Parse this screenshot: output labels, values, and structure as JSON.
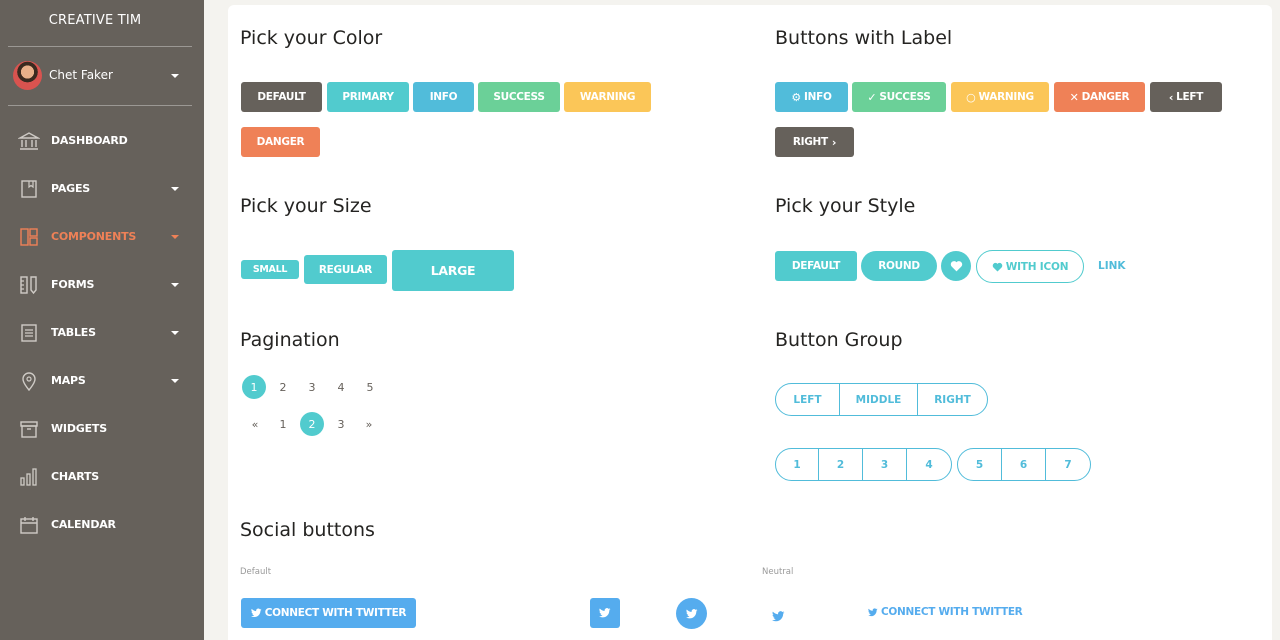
{
  "sidebar": {
    "brand": "CREATIVE TIM",
    "user": {
      "name": "Chet Faker"
    },
    "items": [
      {
        "label": "DASHBOARD",
        "icon": "bank-icon",
        "has_caret": false,
        "active": false
      },
      {
        "label": "PAGES",
        "icon": "book-icon",
        "has_caret": true,
        "active": false
      },
      {
        "label": "COMPONENTS",
        "icon": "layout-icon",
        "has_caret": true,
        "active": true
      },
      {
        "label": "FORMS",
        "icon": "ruler-pencil-icon",
        "has_caret": true,
        "active": false
      },
      {
        "label": "TABLES",
        "icon": "paper-icon",
        "has_caret": true,
        "active": false
      },
      {
        "label": "MAPS",
        "icon": "pin-icon",
        "has_caret": true,
        "active": false
      },
      {
        "label": "WIDGETS",
        "icon": "box-icon",
        "has_caret": false,
        "active": false
      },
      {
        "label": "CHARTS",
        "icon": "chart-bars-icon",
        "has_caret": false,
        "active": false
      },
      {
        "label": "CALENDAR",
        "icon": "calendar-icon",
        "has_caret": false,
        "active": false
      }
    ]
  },
  "colors": {
    "sidebar_bg": "#66615b",
    "active": "#ef8157",
    "default": "#66615b",
    "primary": "#51cbce",
    "info": "#51bcda",
    "success": "#6bd098",
    "warning": "#fbc658",
    "danger": "#ef8157",
    "twitter": "#55acee"
  },
  "color_section": {
    "title": "Pick your Color",
    "buttons": [
      "DEFAULT",
      "PRIMARY",
      "INFO",
      "SUCCESS",
      "WARNING",
      "DANGER"
    ]
  },
  "label_section": {
    "title": "Buttons with Label",
    "buttons": [
      {
        "label": "INFO",
        "icon": "gear-icon"
      },
      {
        "label": "SUCCESS",
        "icon": "check-icon"
      },
      {
        "label": "WARNING",
        "icon": "zoom-icon"
      },
      {
        "label": "DANGER",
        "icon": "close-icon"
      },
      {
        "label": "LEFT",
        "icon": "chevron-left-icon"
      },
      {
        "label": "RIGHT",
        "icon": "chevron-right-icon"
      }
    ]
  },
  "size_section": {
    "title": "Pick your Size",
    "small": "SMALL",
    "regular": "REGULAR",
    "large": "LARGE"
  },
  "style_section": {
    "title": "Pick your Style",
    "default": "DEFAULT",
    "round": "ROUND",
    "with_icon": "WITH ICON",
    "link": "LINK"
  },
  "pagination": {
    "title": "Pagination",
    "row1": [
      "1",
      "2",
      "3",
      "4",
      "5"
    ],
    "row1_active": "1",
    "row2": [
      "«",
      "1",
      "2",
      "3",
      "»"
    ],
    "row2_active": "2"
  },
  "button_group": {
    "title": "Button Group",
    "text_group": [
      "LEFT",
      "MIDDLE",
      "RIGHT"
    ],
    "num_group_a": [
      "1",
      "2",
      "3",
      "4"
    ],
    "num_group_b": [
      "5",
      "6",
      "7"
    ]
  },
  "social": {
    "title": "Social buttons",
    "default_label": "Default",
    "neutral_label": "Neutral",
    "connect_label": "CONNECT WITH TWITTER"
  }
}
